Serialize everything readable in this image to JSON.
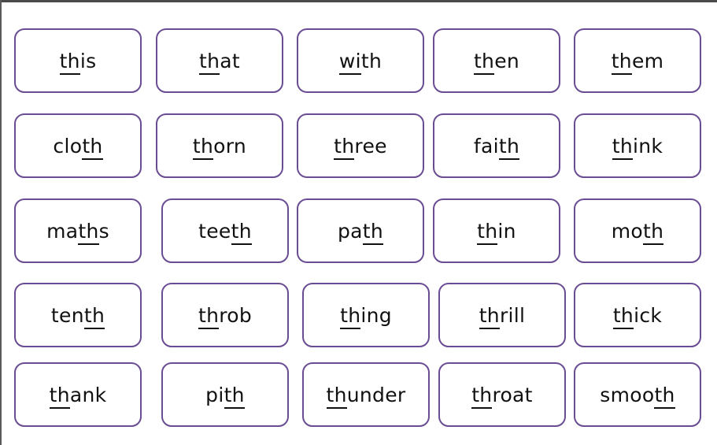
{
  "theme": {
    "card_border_color": "#6a4c93",
    "text_color": "#111111",
    "frame_color": "#4a4a4a"
  },
  "cards": [
    [
      {
        "parts": [
          {
            "text": "th",
            "u": true
          },
          {
            "text": "is",
            "u": false
          }
        ],
        "word": "this"
      },
      {
        "parts": [
          {
            "text": "th",
            "u": true
          },
          {
            "text": "at",
            "u": false
          }
        ],
        "word": "that"
      },
      {
        "parts": [
          {
            "text": "wi",
            "u": true
          },
          {
            "text": "th",
            "u": false
          }
        ],
        "word": "with"
      },
      {
        "parts": [
          {
            "text": "th",
            "u": true
          },
          {
            "text": "en",
            "u": false
          }
        ],
        "word": "then"
      },
      {
        "parts": [
          {
            "text": "th",
            "u": true
          },
          {
            "text": "em",
            "u": false
          }
        ],
        "word": "them"
      }
    ],
    [
      {
        "parts": [
          {
            "text": "clo",
            "u": false
          },
          {
            "text": "th",
            "u": true
          }
        ],
        "word": "cloth"
      },
      {
        "parts": [
          {
            "text": "th",
            "u": true
          },
          {
            "text": "orn",
            "u": false
          }
        ],
        "word": "thorn"
      },
      {
        "parts": [
          {
            "text": "th",
            "u": true
          },
          {
            "text": "ree",
            "u": false
          }
        ],
        "word": "three"
      },
      {
        "parts": [
          {
            "text": "fai",
            "u": false
          },
          {
            "text": "th",
            "u": true
          }
        ],
        "word": "faith"
      },
      {
        "parts": [
          {
            "text": "th",
            "u": true
          },
          {
            "text": "ink",
            "u": false
          }
        ],
        "word": "think"
      }
    ],
    [
      {
        "parts": [
          {
            "text": "ma",
            "u": false
          },
          {
            "text": "th",
            "u": true
          },
          {
            "text": "s",
            "u": false
          }
        ],
        "word": "maths"
      },
      {
        "parts": [
          {
            "text": "tee",
            "u": false
          },
          {
            "text": "th",
            "u": true
          }
        ],
        "word": "teeth"
      },
      {
        "parts": [
          {
            "text": "pa",
            "u": false
          },
          {
            "text": "th",
            "u": true
          }
        ],
        "word": "path"
      },
      {
        "parts": [
          {
            "text": "th",
            "u": true
          },
          {
            "text": "in",
            "u": false
          }
        ],
        "word": "thin"
      },
      {
        "parts": [
          {
            "text": "mo",
            "u": false
          },
          {
            "text": "th",
            "u": true
          }
        ],
        "word": "moth"
      }
    ],
    [
      {
        "parts": [
          {
            "text": "ten",
            "u": false
          },
          {
            "text": "th",
            "u": true
          }
        ],
        "word": "tenth"
      },
      {
        "parts": [
          {
            "text": "th",
            "u": true
          },
          {
            "text": "rob",
            "u": false
          }
        ],
        "word": "throb"
      },
      {
        "parts": [
          {
            "text": "th",
            "u": true
          },
          {
            "text": "ing",
            "u": false
          }
        ],
        "word": "thing"
      },
      {
        "parts": [
          {
            "text": "th",
            "u": true
          },
          {
            "text": "rill",
            "u": false
          }
        ],
        "word": "thrill"
      },
      {
        "parts": [
          {
            "text": "th",
            "u": true
          },
          {
            "text": "ick",
            "u": false
          }
        ],
        "word": "thick"
      }
    ],
    [
      {
        "parts": [
          {
            "text": "th",
            "u": true
          },
          {
            "text": "ank",
            "u": false
          }
        ],
        "word": "thank"
      },
      {
        "parts": [
          {
            "text": "pi",
            "u": false
          },
          {
            "text": "th",
            "u": true
          }
        ],
        "word": "pith"
      },
      {
        "parts": [
          {
            "text": "th",
            "u": true
          },
          {
            "text": "under",
            "u": false
          }
        ],
        "word": "thunder"
      },
      {
        "parts": [
          {
            "text": "th",
            "u": true
          },
          {
            "text": "roat",
            "u": false
          }
        ],
        "word": "throat"
      },
      {
        "parts": [
          {
            "text": "smoo",
            "u": false
          },
          {
            "text": "th",
            "u": true
          }
        ],
        "word": "smooth"
      }
    ]
  ]
}
